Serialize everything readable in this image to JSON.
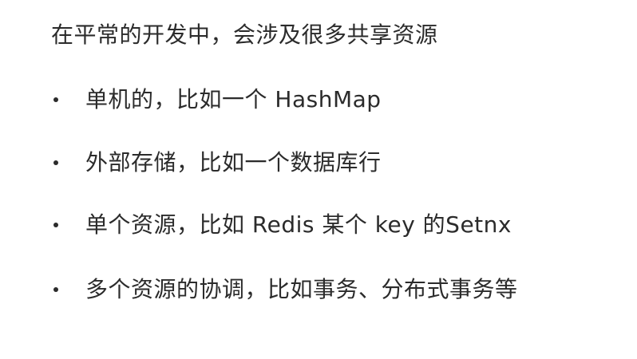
{
  "intro": "在平常的开发中，会涉及很多共享资源",
  "bullets": [
    {
      "text": "单机的，比如一个 HashMap"
    },
    {
      "text": "外部存储，比如一个数据库行"
    },
    {
      "text": "单个资源，比如 Redis 某个 key 的Setnx"
    },
    {
      "text": "多个资源的协调，比如事务、分布式事务等"
    }
  ]
}
